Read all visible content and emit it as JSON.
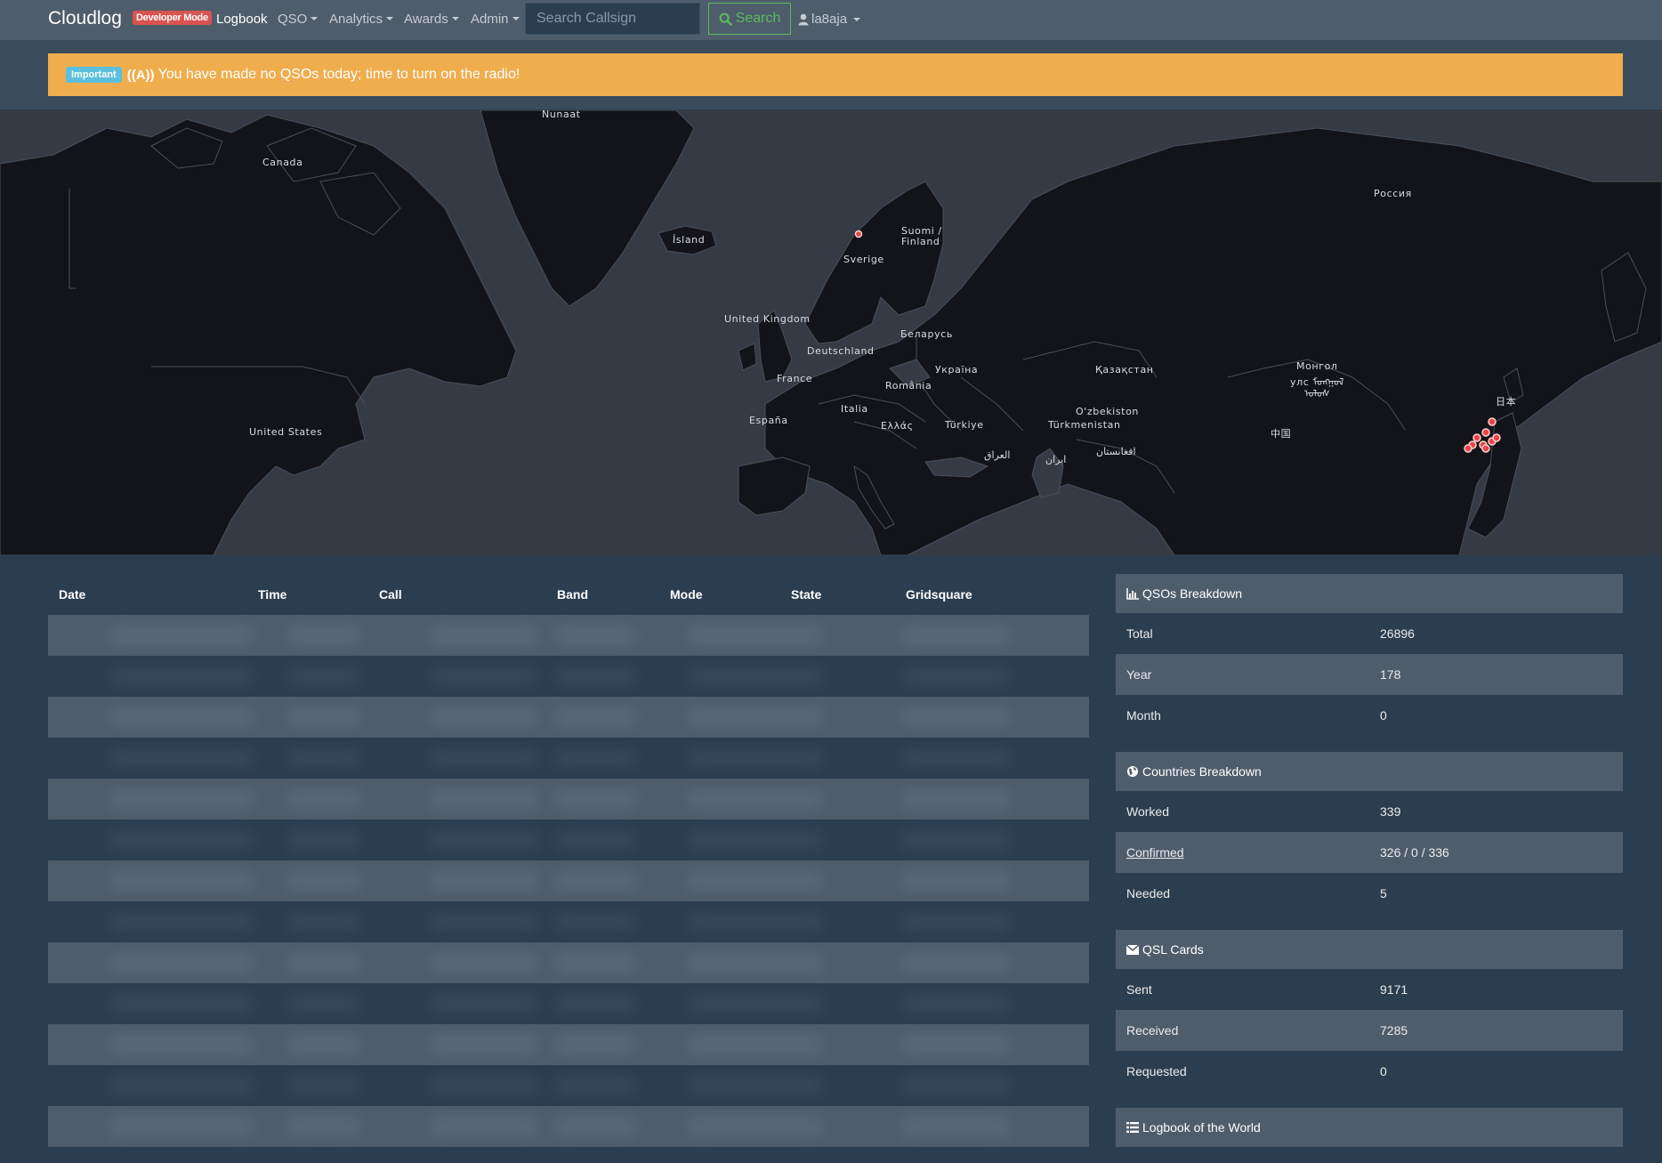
{
  "navbar": {
    "brand": "Cloudlog",
    "dev_badge": "Developer Mode",
    "logbook": "Logbook",
    "qso": "QSO",
    "analytics": "Analytics",
    "awards": "Awards",
    "admin": "Admin",
    "search_placeholder": "Search Callsign",
    "search_label": "Search",
    "user": "la8aja"
  },
  "alert": {
    "badge": "Important",
    "icon": "((A))",
    "message": "You have made no QSOs today; time to turn on the radio!"
  },
  "map": {
    "labels": {
      "nunaat": "Nunaat",
      "canada": "Canada",
      "island": "Ísland",
      "suomi": "Suomi /",
      "finland": "Finland",
      "sverige": "Sverige",
      "rossiya": "Россия",
      "uk": "United Kingdom",
      "belarus": "Беларусь",
      "deutschland": "Deutschland",
      "ukraina": "Україна",
      "kazakhstan": "Қазақстан",
      "mongol": "Монгол",
      "mongol2": "улс ᠮᠣᠩᠭᠣᠯ",
      "mongol3": "ᠤᠯᠤᠰ",
      "france": "France",
      "romania": "România",
      "nihon": "日本",
      "italia": "Italia",
      "uzbekiston": "O'zbekiston",
      "espana": "España",
      "ellas": "Ελλάς",
      "turkiye": "Türkiye",
      "turkmenistan": "Türkmenistan",
      "zhongguo": "中国",
      "us": "United States",
      "iraq": "العراق",
      "iran": "ایران",
      "afghanistan": "افغانستان"
    }
  },
  "table": {
    "headers": [
      "Date",
      "Time",
      "Call",
      "Band",
      "Mode",
      "State",
      "Gridsquare"
    ]
  },
  "qsos_breakdown": {
    "title": "QSOs Breakdown",
    "rows": [
      {
        "label": "Total",
        "value": "26896"
      },
      {
        "label": "Year",
        "value": "178"
      },
      {
        "label": "Month",
        "value": "0"
      }
    ]
  },
  "countries_breakdown": {
    "title": "Countries Breakdown",
    "rows": [
      {
        "label": "Worked",
        "value": "339"
      },
      {
        "label": "Confirmed",
        "value": "326 / 0 / 336"
      },
      {
        "label": "Needed",
        "value": "5"
      }
    ]
  },
  "qsl_cards": {
    "title": "QSL Cards",
    "rows": [
      {
        "label": "Sent",
        "value": "9171"
      },
      {
        "label": "Received",
        "value": "7285"
      },
      {
        "label": "Requested",
        "value": "0"
      }
    ]
  },
  "lotw": {
    "title": "Logbook of the World"
  },
  "colors": {
    "navbar": "#4e5d6c",
    "background": "#2b3e50",
    "alert": "#f0ad4e",
    "dev_badge": "#d9534f",
    "info_badge": "#5bc0de",
    "search_button": "#5cb85c",
    "map_marker": "#e84545"
  }
}
